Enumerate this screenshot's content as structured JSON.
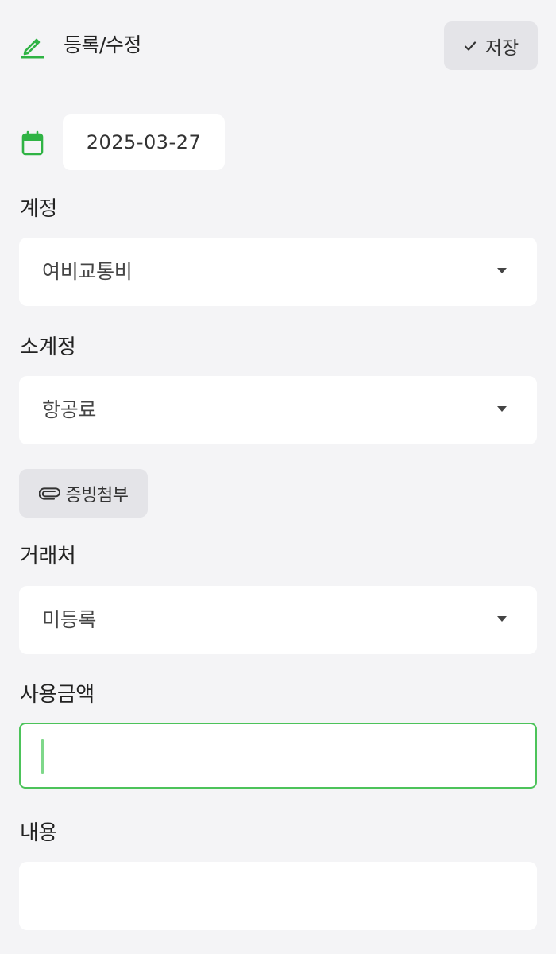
{
  "header": {
    "title": "등록/수정",
    "save_label": "저장"
  },
  "date": {
    "value": "2025-03-27"
  },
  "account": {
    "label": "계정",
    "selected": "여비교통비"
  },
  "sub_account": {
    "label": "소계정",
    "selected": "항공료"
  },
  "attach": {
    "label": "증빙첨부"
  },
  "vendor": {
    "label": "거래처",
    "selected": "미등록"
  },
  "amount": {
    "label": "사용금액",
    "value": ""
  },
  "content": {
    "label": "내용",
    "value": ""
  },
  "colors": {
    "accent": "#4cc35a",
    "background": "#f4f4f6",
    "button_bg": "#e4e4e8",
    "field_bg": "#ffffff"
  },
  "icons": {
    "header": "pencil-icon",
    "save": "check-icon",
    "date": "calendar-icon",
    "dropdown": "caret-down-icon",
    "attach": "paperclip-icon"
  }
}
